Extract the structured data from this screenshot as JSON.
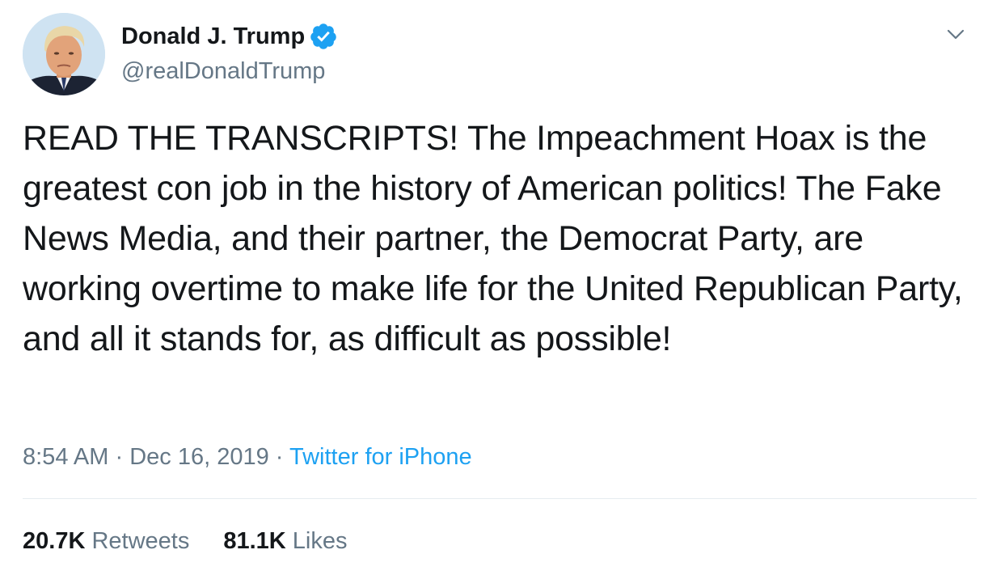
{
  "tweet": {
    "author": {
      "name": "Donald J. Trump",
      "handle": "@realDonaldTrump",
      "verified": true,
      "avatar": "profile-photo"
    },
    "text": "READ THE TRANSCRIPTS! The Impeachment Hoax is the greatest con job in the history of American politics! The Fake News Media, and their partner, the Democrat Party, are working overtime to make life for the United Republican Party, and all it stands for, as difficult as possible!",
    "time": "8:54 AM",
    "separator": "·",
    "date": "Dec 16, 2019",
    "source": "Twitter for iPhone",
    "stats": {
      "retweets_count": "20.7K",
      "retweets_label": "Retweets",
      "likes_count": "81.1K",
      "likes_label": "Likes"
    }
  },
  "icons": {
    "verified": "verified-badge-icon",
    "menu": "chevron-down-icon"
  },
  "colors": {
    "text": "#14171a",
    "secondary": "#657786",
    "link": "#1da1f2",
    "divider": "#e6ecf0"
  }
}
